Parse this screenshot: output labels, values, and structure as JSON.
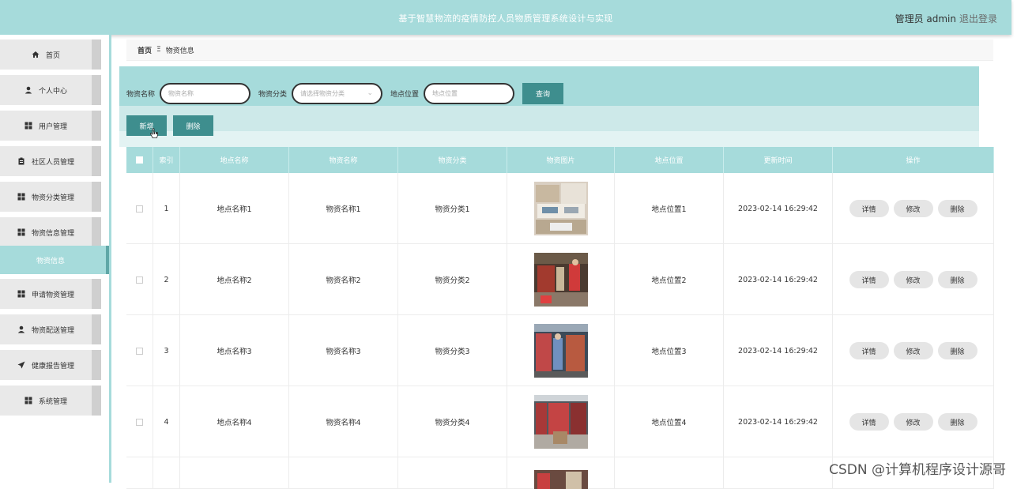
{
  "header": {
    "title": "基于智慧物流的疫情防控人员物质管理系统设计与实现",
    "user": "管理员 admin",
    "logout": "退出登录"
  },
  "sidebar": {
    "items": [
      {
        "label": "首页",
        "icon": "home-icon"
      },
      {
        "label": "个人中心",
        "icon": "user-icon"
      },
      {
        "label": "用户管理",
        "icon": "grid-icon"
      },
      {
        "label": "社区人员管理",
        "icon": "clipboard-icon"
      },
      {
        "label": "物资分类管理",
        "icon": "grid-icon"
      },
      {
        "label": "物资信息管理",
        "icon": "grid-icon"
      },
      {
        "label": "物资信息",
        "icon": "",
        "active": true
      },
      {
        "label": "申请物资管理",
        "icon": "grid-icon"
      },
      {
        "label": "物资配送管理",
        "icon": "user-icon"
      },
      {
        "label": "健康报告管理",
        "icon": "send-icon"
      },
      {
        "label": "系统管理",
        "icon": "grid-icon"
      }
    ]
  },
  "breadcrumb": {
    "home": "首页",
    "sep": "Ξ",
    "current": "物资信息"
  },
  "search": {
    "name_label": "物资名称",
    "name_placeholder": "物资名称",
    "cat_label": "物资分类",
    "cat_placeholder": "请选择物资分类",
    "loc_label": "地点位置",
    "loc_placeholder": "地点位置",
    "query_button": "查询"
  },
  "actions": {
    "add": "新增",
    "delete": "删除"
  },
  "table": {
    "headers": [
      "",
      "索引",
      "地点名称",
      "物资名称",
      "物资分类",
      "物资图片",
      "地点位置",
      "更新时间",
      "操作"
    ],
    "op_labels": {
      "detail": "详情",
      "edit": "修改",
      "delete": "删除"
    },
    "rows": [
      {
        "index": "1",
        "place": "地点名称1",
        "name": "物资名称1",
        "category": "物资分类1",
        "location": "地点位置1",
        "updated": "2023-02-14 16:29:42"
      },
      {
        "index": "2",
        "place": "地点名称2",
        "name": "物资名称2",
        "category": "物资分类2",
        "location": "地点位置2",
        "updated": "2023-02-14 16:29:42"
      },
      {
        "index": "3",
        "place": "地点名称3",
        "name": "物资名称3",
        "category": "物资分类3",
        "location": "地点位置3",
        "updated": "2023-02-14 16:29:42"
      },
      {
        "index": "4",
        "place": "地点名称4",
        "name": "物资名称4",
        "category": "物资分类4",
        "location": "地点位置4",
        "updated": "2023-02-14 16:29:42"
      }
    ]
  },
  "watermark": "CSDN @计算机程序设计源哥",
  "colors": {
    "accent": "#a6dbdb",
    "button": "#3e8e8e"
  }
}
